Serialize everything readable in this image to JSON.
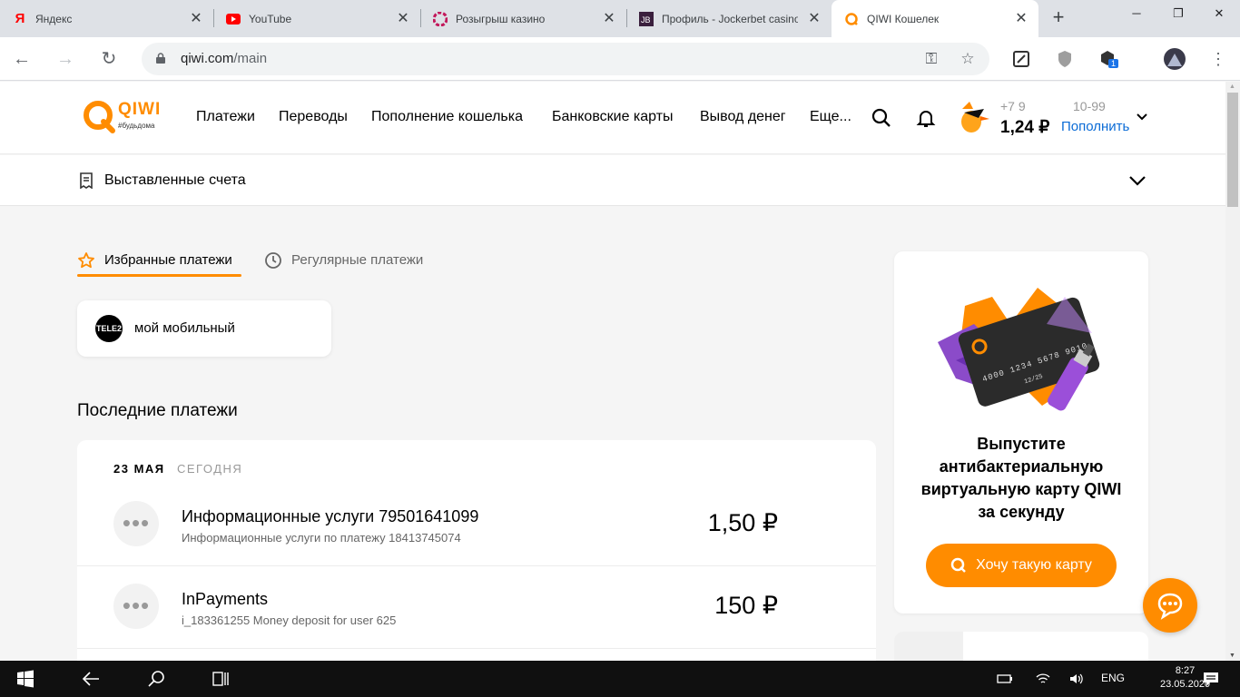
{
  "browser": {
    "tabs": [
      {
        "title": "Яндекс",
        "icon": "yandex-icon"
      },
      {
        "title": "YouTube",
        "icon": "youtube-icon"
      },
      {
        "title": "Розыгрыш казино",
        "icon": "casino-icon"
      },
      {
        "title": "Профиль - Jockerbet casino",
        "icon": "jb-icon"
      },
      {
        "title": "QIWI Кошелек",
        "icon": "qiwi-icon",
        "active": true
      }
    ],
    "url_host": "qiwi.com",
    "url_path": "/main",
    "extension_badge": "1"
  },
  "header": {
    "logo_text": "QIWI",
    "logo_tagline": "#будьдома",
    "menu": [
      "Платежи",
      "Переводы",
      "Пополнение кошелька",
      "Банковские карты",
      "Вывод денег",
      "Еще..."
    ],
    "phone_prefix": "+7 9",
    "phone_suffix": "10-99",
    "balance": "1,24 ₽",
    "topup_label": "Пополнить"
  },
  "invoices": {
    "label": "Выставленные счета"
  },
  "payment_tabs": [
    {
      "label": "Избранные платежи",
      "icon": "star-icon",
      "active": true
    },
    {
      "label": "Регулярные платежи",
      "icon": "clock-icon",
      "active": false
    }
  ],
  "favorites": [
    {
      "logo": "TELE2",
      "name": "мой мобильный"
    }
  ],
  "recent": {
    "title": "Последние платежи",
    "date_label": "23 МАЯ",
    "day_label": "СЕГОДНЯ",
    "items": [
      {
        "title": "Информационные услуги 79501641099",
        "subtitle": "Информационные услуги по платежу 18413745074",
        "amount": "1,50 ₽"
      },
      {
        "title": "InPayments",
        "subtitle": "i_183361255 Money deposit for user 625",
        "amount": "150 ₽"
      }
    ]
  },
  "promo": {
    "text": "Выпустите антибактериальную виртуальную карту QIWI за секунду",
    "button": "Хочу такую карту",
    "card_number": "4000 1234 5678 9010",
    "card_expiry": "12/25"
  },
  "taskbar": {
    "lang": "ENG",
    "time": "8:27",
    "date": "23.05.2020"
  },
  "colors": {
    "accent": "#ff8c00",
    "link": "#0a6bd6"
  }
}
